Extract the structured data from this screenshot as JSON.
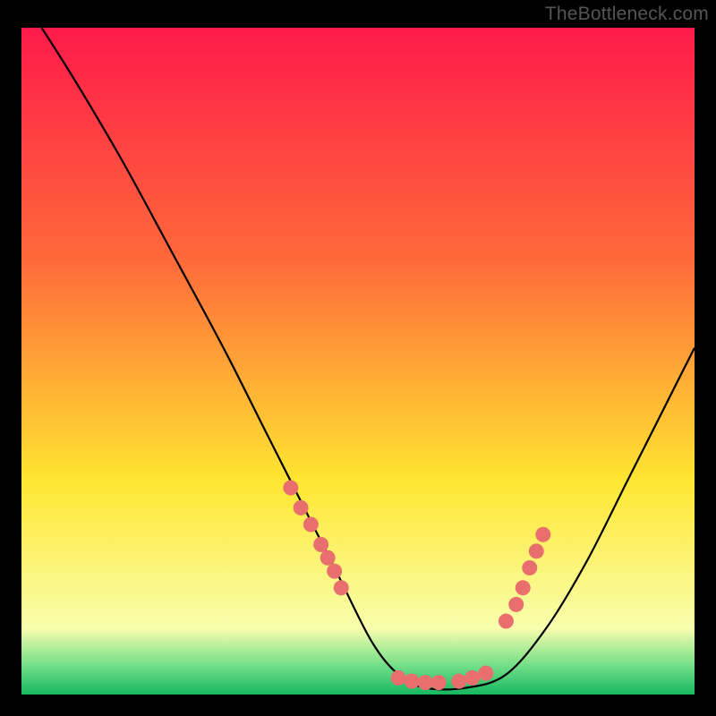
{
  "watermark": "TheBottleneck.com",
  "colors": {
    "gradient_top": "#ff1a4a",
    "gradient_mid1": "#ff6a3a",
    "gradient_mid2": "#ffe631",
    "gradient_low": "#f9ffad",
    "gradient_base1": "#6bdc86",
    "gradient_base2": "#16b760",
    "curve": "#000000",
    "marker": "#e96f6f"
  },
  "chart_data": {
    "type": "line",
    "title": "",
    "xlabel": "",
    "ylabel": "",
    "xlim": [
      0,
      100
    ],
    "ylim": [
      0,
      100
    ],
    "grid": false,
    "legend": false,
    "series": [
      {
        "name": "bottleneck-curve",
        "x": [
          3,
          8,
          15,
          22,
          30,
          36,
          42,
          47,
          52,
          56,
          60,
          66,
          72,
          78,
          84,
          90,
          96,
          100
        ],
        "y": [
          100,
          92,
          80,
          67,
          52,
          40,
          28,
          18,
          8,
          3,
          1,
          1,
          3,
          10,
          20,
          32,
          44,
          52
        ]
      }
    ],
    "markers": [
      {
        "name": "left-cluster",
        "x": [
          40,
          41.5,
          43,
          44.5,
          45.5,
          46.5,
          47.5
        ],
        "y": [
          31,
          28,
          25.5,
          22.5,
          20.5,
          18.5,
          16
        ]
      },
      {
        "name": "bottom-cluster",
        "x": [
          56,
          58,
          60,
          62,
          65,
          67,
          69
        ],
        "y": [
          2.5,
          2,
          1.8,
          1.8,
          2,
          2.5,
          3.2
        ]
      },
      {
        "name": "right-cluster",
        "x": [
          72,
          73.5,
          74.5,
          75.5,
          76.5,
          77.5
        ],
        "y": [
          11,
          13.5,
          16,
          19,
          21.5,
          24
        ]
      }
    ]
  }
}
